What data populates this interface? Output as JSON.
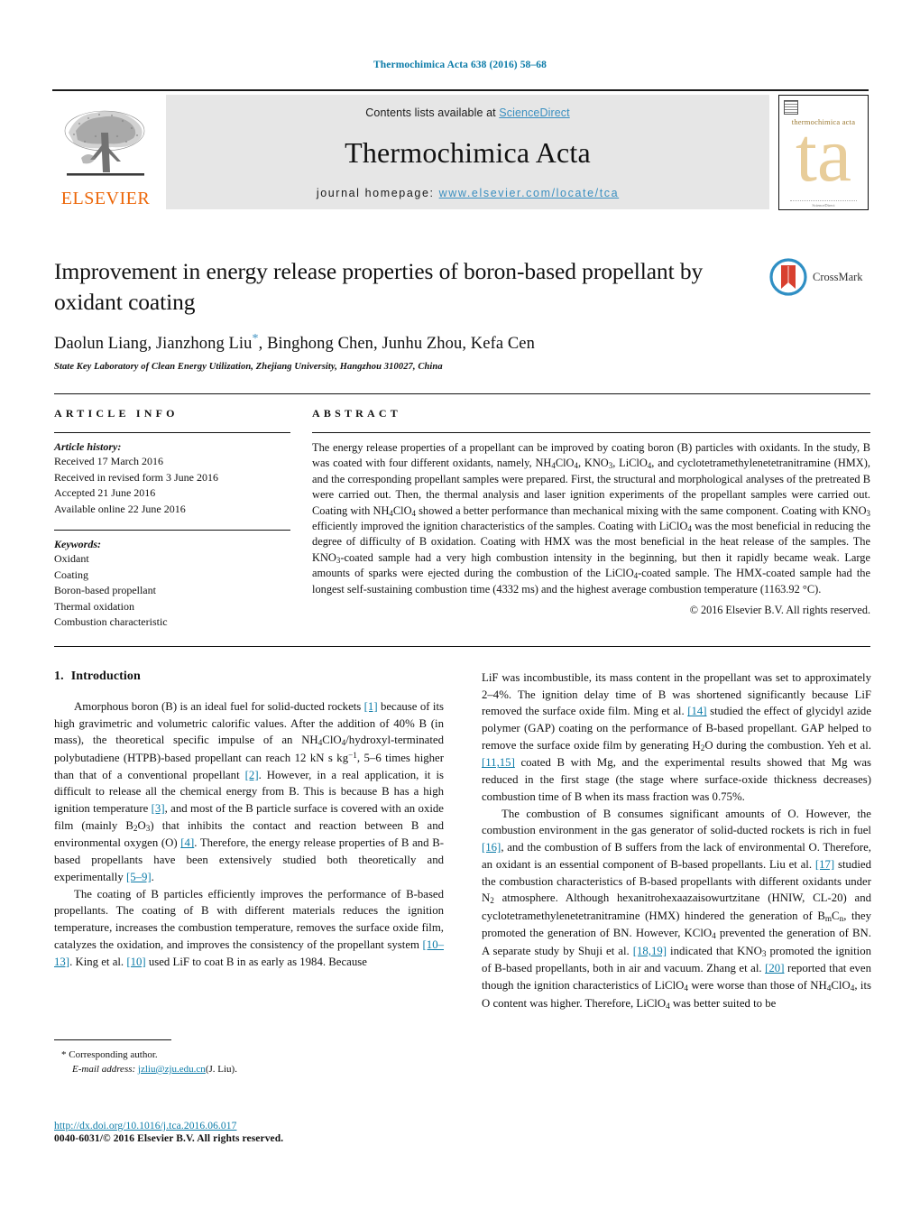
{
  "running_head": "Thermochimica Acta 638 (2016) 58–68",
  "masthead": {
    "contents_prefix": "Contents lists available at ",
    "sciencedirect": "ScienceDirect",
    "journal_name": "Thermochimica Acta",
    "homepage_prefix": "journal homepage: ",
    "homepage_url": "www.elsevier.com/locate/tca",
    "publisher_logo_text": "ELSEVIER",
    "cover_title": "thermochimica acta",
    "cover_monogram": "ta"
  },
  "article": {
    "title": "Improvement in energy release properties of boron-based propellant by oxidant coating",
    "crossmark_label": "CrossMark",
    "authors_before_star": "Daolun Liang, Jianzhong Liu",
    "author_star": "*",
    "authors_after_star": ", Binghong Chen, Junhu Zhou, Kefa Cen",
    "affiliation": "State Key Laboratory of Clean Energy Utilization, Zhejiang University, Hangzhou 310027, China"
  },
  "article_info": {
    "heading": "ARTICLE INFO",
    "history_label": "Article history:",
    "history": [
      "Received 17 March 2016",
      "Received in revised form 3 June 2016",
      "Accepted 21 June 2016",
      "Available online 22 June 2016"
    ],
    "keywords_label": "Keywords:",
    "keywords": [
      "Oxidant",
      "Coating",
      "Boron-based propellant",
      "Thermal oxidation",
      "Combustion characteristic"
    ]
  },
  "abstract": {
    "heading": "ABSTRACT",
    "text_parts": [
      "The energy release properties of a propellant can be improved by coating boron (B) particles with oxidants. In the study, B was coated with four different oxidants, namely, NH",
      "4",
      "ClO",
      "4",
      ", KNO",
      "3",
      ", LiClO",
      "4",
      ", and cyclotetramethylenetetranitramine (HMX), and the corresponding propellant samples were prepared. First, the structural and morphological analyses of the pretreated B were carried out. Then, the thermal analysis and laser ignition experiments of the propellant samples were carried out. Coating with NH",
      "4",
      "ClO",
      "4",
      " showed a better performance than mechanical mixing with the same component. Coating with KNO",
      "3",
      " efficiently improved the ignition characteristics of the samples. Coating with LiClO",
      "4",
      " was the most beneficial in reducing the degree of difficulty of B oxidation. Coating with HMX was the most beneficial in the heat release of the samples. The KNO",
      "3",
      "-coated sample had a very high combustion intensity in the beginning, but then it rapidly became weak. Large amounts of sparks were ejected during the combustion of the LiClO",
      "4",
      "-coated sample. The HMX-coated sample had the longest self-sustaining combustion time (4332 ms) and the highest average combustion temperature (1163.92 °C)."
    ],
    "copyright": "© 2016 Elsevier B.V. All rights reserved."
  },
  "introduction": {
    "number": "1.",
    "heading": "Introduction"
  },
  "footnote": {
    "corresponding_author": "* Corresponding author.",
    "email_label": "E-mail address:",
    "email": "jzliu@zju.edu.cn",
    "email_owner": "(J. Liu)."
  },
  "footer": {
    "doi": "http://dx.doi.org/10.1016/j.tca.2016.06.017",
    "issn_line": "0040-6031/© 2016 Elsevier B.V. All rights reserved."
  }
}
